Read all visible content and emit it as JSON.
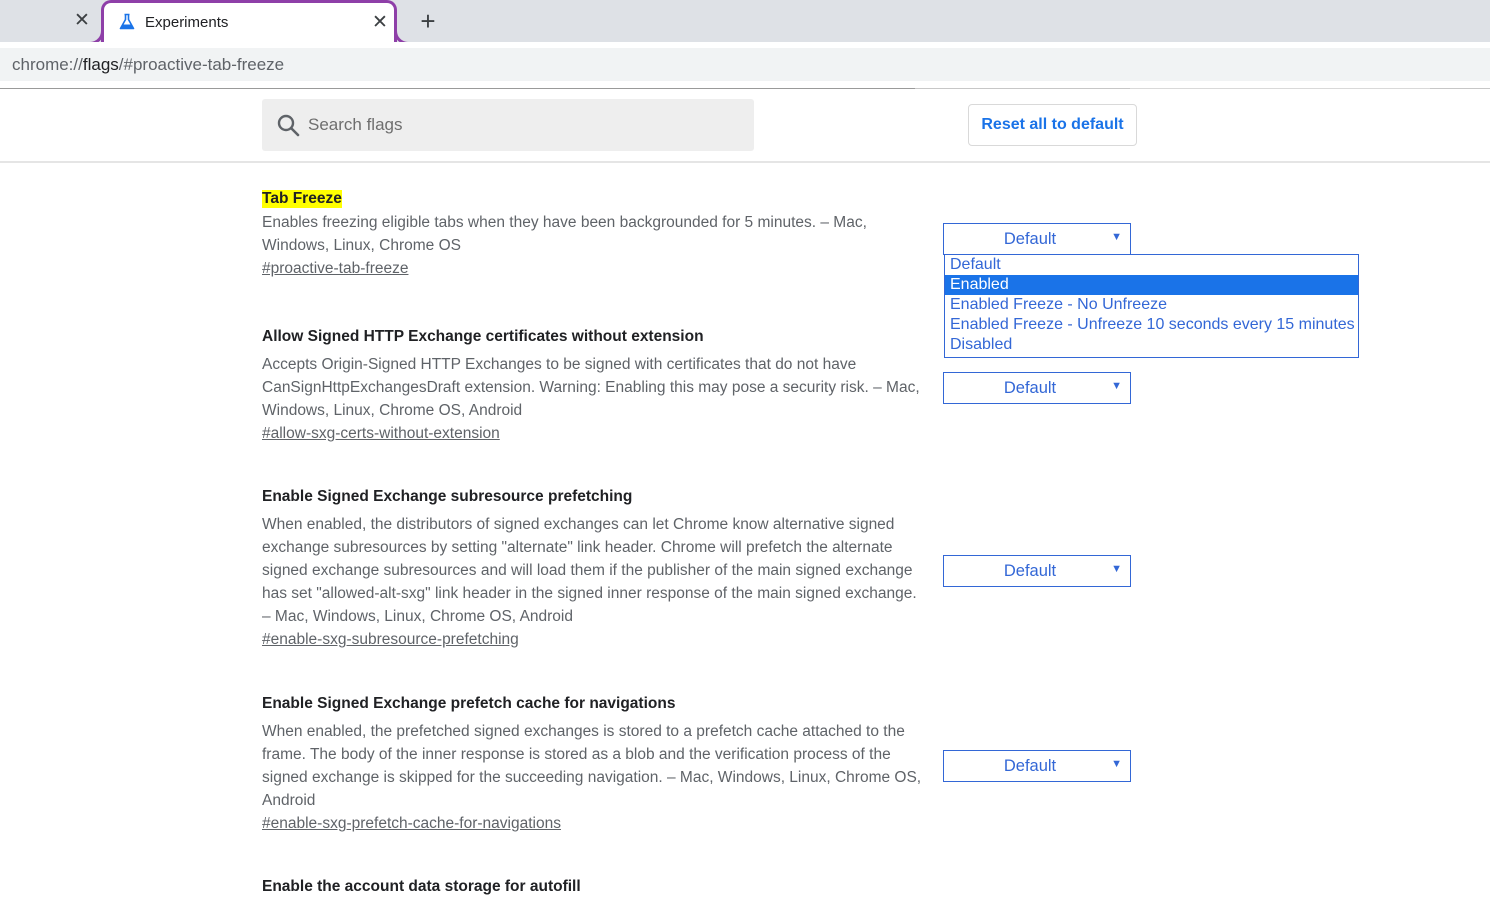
{
  "browser": {
    "tabs": [
      {
        "title": "",
        "close": "✕",
        "active": false
      },
      {
        "title": "Experiments",
        "close": "✕",
        "active": true,
        "icon": "flask-icon"
      }
    ],
    "new_tab": "+",
    "url": {
      "scheme": "chrome://",
      "host": "flags",
      "path": "/#proactive-tab-freeze"
    }
  },
  "header": {
    "search_placeholder": "Search flags",
    "reset_label": "Reset all to default"
  },
  "colors": {
    "accent": "#1a73e8",
    "select_blue": "#3367d6",
    "highlight": "#ffff00",
    "tab_border": "#8e3fa8"
  },
  "experiments": [
    {
      "title": "Tab Freeze",
      "description": "Enables freezing eligible tabs when they have been backgrounded for 5 minutes. – Mac, Windows, Linux, Chrome OS",
      "link": "#proactive-tab-freeze",
      "value": "Default"
    },
    {
      "title": "Allow Signed HTTP Exchange certificates without extension",
      "description": "Accepts Origin-Signed HTTP Exchanges to be signed with certificates that do not have CanSignHttpExchangesDraft extension. Warning: Enabling this may pose a security risk. – Mac, Windows, Linux, Chrome OS, Android",
      "link": "#allow-sxg-certs-without-extension",
      "value": "Default"
    },
    {
      "title": "Enable Signed Exchange subresource prefetching",
      "description": "When enabled, the distributors of signed exchanges can let Chrome know alternative signed exchange subresources by setting \"alternate\" link header. Chrome will prefetch the alternate signed exchange subresources and will load them if the publisher of the main signed exchange has set \"allowed-alt-sxg\" link header in the signed inner response of the main signed exchange. – Mac, Windows, Linux, Chrome OS, Android",
      "link": "#enable-sxg-subresource-prefetching",
      "value": "Default"
    },
    {
      "title": "Enable Signed Exchange prefetch cache for navigations",
      "description": "When enabled, the prefetched signed exchanges is stored to a prefetch cache attached to the frame. The body of the inner response is stored as a blob and the verification process of the signed exchange is skipped for the succeeding navigation. – Mac, Windows, Linux, Chrome OS, Android",
      "link": "#enable-sxg-prefetch-cache-for-navigations",
      "value": "Default"
    },
    {
      "title": "Enable the account data storage for autofill",
      "description": "",
      "link": "",
      "value": ""
    }
  ],
  "dropdown": {
    "options": [
      "Default",
      "Enabled",
      "Enabled Freeze - No Unfreeze",
      "Enabled Freeze - Unfreeze 10 seconds every 15 minutes",
      "Disabled"
    ],
    "highlighted": "Enabled"
  }
}
